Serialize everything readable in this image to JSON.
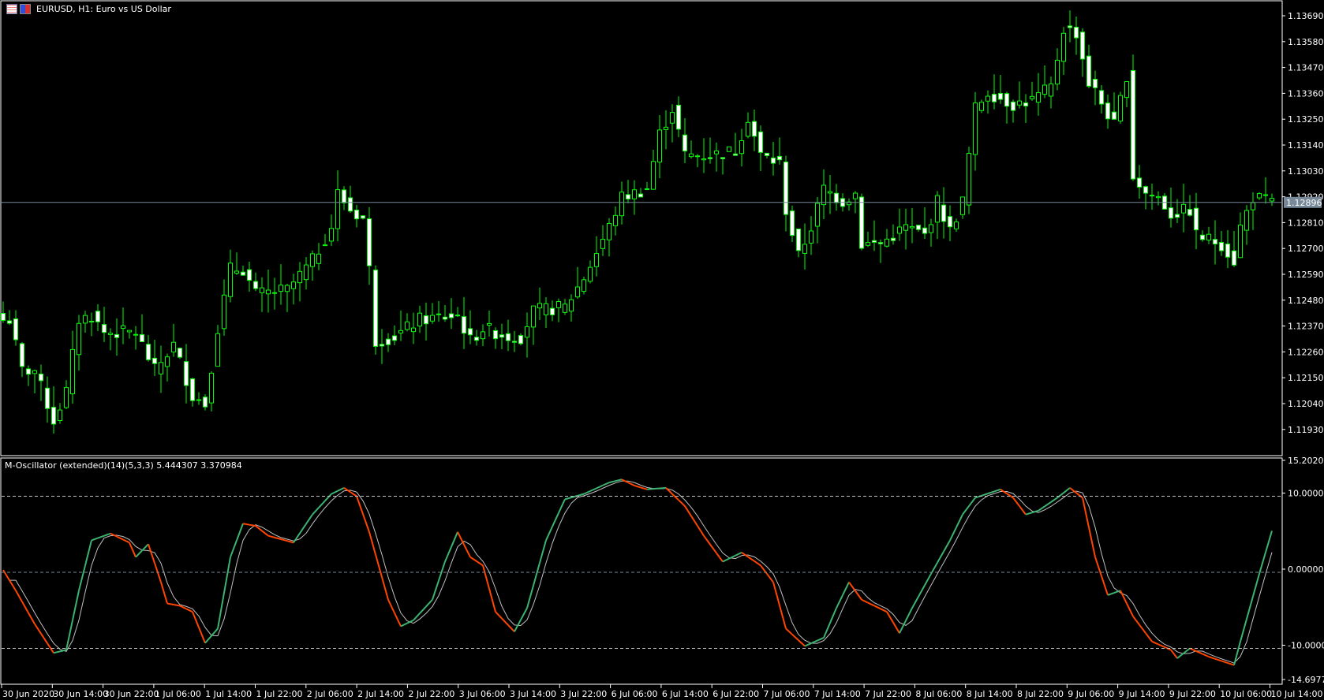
{
  "header": {
    "title": "EURUSD, H1:  Euro vs US Dollar",
    "icons": [
      "chart-window-icon",
      "trade-icon"
    ]
  },
  "current_price": {
    "value": 1.12896,
    "label": "1.12896",
    "line_color": "#778899"
  },
  "indicator": {
    "label": "M-Oscillator (extended)(14)(5,3,3) 5.444307 3.370984",
    "main_value": 5.444307,
    "signal_value": 3.370984,
    "up_color": "#3cb371",
    "down_color": "#ff4500",
    "signal_color": "#c0c0c0"
  },
  "colors": {
    "candle": "#00ff00",
    "bear_fill": "#ffffff",
    "bull_fill": "#000000",
    "grid": "#ffffff"
  },
  "chart_data": [
    {
      "type": "candlestick",
      "title": "EURUSD, H1",
      "bar_count": 202,
      "y_ticks": [
        "1.13690",
        "1.13580",
        "1.13470",
        "1.13360",
        "1.13250",
        "1.13140",
        "1.13030",
        "1.12920",
        "1.12810",
        "1.12700",
        "1.12590",
        "1.12480",
        "1.12370",
        "1.12260",
        "1.12150",
        "1.12040",
        "1.11930"
      ],
      "ylim": [
        1.1184,
        1.1375
      ],
      "close_path": [
        [
          1,
          1.12397
        ],
        [
          3,
          1.12181
        ],
        [
          5,
          1.12181
        ],
        [
          8,
          1.11966
        ],
        [
          10,
          1.12092
        ],
        [
          12,
          1.12397
        ],
        [
          14,
          1.12415
        ],
        [
          16,
          1.12343
        ],
        [
          21,
          1.12343
        ],
        [
          24,
          1.12181
        ],
        [
          27,
          1.12289
        ],
        [
          30,
          1.12074
        ],
        [
          32,
          1.12038
        ],
        [
          34,
          1.12361
        ],
        [
          36,
          1.12612
        ],
        [
          38,
          1.12612
        ],
        [
          40,
          1.12505
        ],
        [
          45,
          1.12523
        ],
        [
          49,
          1.12648
        ],
        [
          52,
          1.12792
        ],
        [
          53,
          1.12936
        ],
        [
          55,
          1.12864
        ],
        [
          57,
          1.12828
        ],
        [
          58,
          1.12612
        ],
        [
          59,
          1.12307
        ],
        [
          62,
          1.12325
        ],
        [
          66,
          1.12397
        ],
        [
          72,
          1.12415
        ],
        [
          74,
          1.12307
        ],
        [
          76,
          1.12361
        ],
        [
          80,
          1.12325
        ],
        [
          82,
          1.12325
        ],
        [
          84,
          1.12433
        ],
        [
          89,
          1.12451
        ],
        [
          92,
          1.12576
        ],
        [
          96,
          1.12792
        ],
        [
          98,
          1.12918
        ],
        [
          102,
          1.12954
        ],
        [
          104,
          1.13187
        ],
        [
          106,
          1.13295
        ],
        [
          108,
          1.13097
        ],
        [
          112,
          1.13097
        ],
        [
          116,
          1.13115
        ],
        [
          118,
          1.13259
        ],
        [
          120,
          1.13097
        ],
        [
          123,
          1.13061
        ],
        [
          124,
          1.12864
        ],
        [
          126,
          1.12666
        ],
        [
          128,
          1.12792
        ],
        [
          130,
          1.12954
        ],
        [
          133,
          1.129
        ],
        [
          135,
          1.12936
        ],
        [
          136,
          1.1272
        ],
        [
          139,
          1.1272
        ],
        [
          143,
          1.12792
        ],
        [
          146,
          1.12756
        ],
        [
          148,
          1.129
        ],
        [
          150,
          1.12774
        ],
        [
          152,
          1.129
        ],
        [
          154,
          1.13295
        ],
        [
          156,
          1.13367
        ],
        [
          160,
          1.13313
        ],
        [
          163,
          1.13331
        ],
        [
          166,
          1.13385
        ],
        [
          168,
          1.13636
        ],
        [
          170,
          1.13618
        ],
        [
          172,
          1.13403
        ],
        [
          173,
          1.13367
        ],
        [
          176,
          1.13223
        ],
        [
          178,
          1.13439
        ],
        [
          179,
          1.13008
        ],
        [
          181,
          1.12936
        ],
        [
          183,
          1.12918
        ],
        [
          185,
          1.12846
        ],
        [
          188,
          1.12864
        ],
        [
          189,
          1.12756
        ],
        [
          193,
          1.1272
        ],
        [
          195,
          1.12648
        ],
        [
          196,
          1.12792
        ],
        [
          198,
          1.12918
        ],
        [
          201,
          1.12896
        ]
      ]
    },
    {
      "type": "line",
      "title": "M-Oscillator (extended)(14)(5,3,3)",
      "y_ticks": [
        "15.202020",
        "10.000000",
        "0.000000",
        "-10.000000",
        "-14.697713"
      ],
      "levels": [
        10,
        0,
        -10
      ],
      "ylim": [
        -14.697713,
        15.20202
      ],
      "main_path": [
        [
          0,
          0.3
        ],
        [
          2,
          -2.4
        ],
        [
          5,
          -6.8
        ],
        [
          8,
          -10.6
        ],
        [
          10,
          -10.2
        ],
        [
          12,
          -2.4
        ],
        [
          14,
          4.2
        ],
        [
          17,
          5.1
        ],
        [
          20,
          3.9
        ],
        [
          21,
          2.0
        ],
        [
          23,
          3.7
        ],
        [
          25,
          -1.3
        ],
        [
          26,
          -4.1
        ],
        [
          28,
          -4.4
        ],
        [
          30,
          -5.2
        ],
        [
          32,
          -9.3
        ],
        [
          34,
          -7.4
        ],
        [
          36,
          2.0
        ],
        [
          38,
          6.4
        ],
        [
          40,
          6.1
        ],
        [
          42,
          4.8
        ],
        [
          46,
          3.9
        ],
        [
          49,
          7.6
        ],
        [
          52,
          10.3
        ],
        [
          54,
          11.1
        ],
        [
          56,
          10.0
        ],
        [
          58,
          5.3
        ],
        [
          61,
          -3.6
        ],
        [
          63,
          -7.1
        ],
        [
          65,
          -6.3
        ],
        [
          68,
          -3.6
        ],
        [
          70,
          1.4
        ],
        [
          72,
          5.3
        ],
        [
          74,
          2.0
        ],
        [
          76,
          0.9
        ],
        [
          78,
          -5.2
        ],
        [
          81,
          -7.8
        ],
        [
          83,
          -4.7
        ],
        [
          86,
          4.2
        ],
        [
          89,
          9.6
        ],
        [
          92,
          10.3
        ],
        [
          96,
          11.8
        ],
        [
          98,
          12.2
        ],
        [
          100,
          11.4
        ],
        [
          102,
          10.9
        ],
        [
          105,
          11.1
        ],
        [
          108,
          8.7
        ],
        [
          111,
          4.8
        ],
        [
          114,
          1.4
        ],
        [
          117,
          2.6
        ],
        [
          120,
          0.9
        ],
        [
          122,
          -1.3
        ],
        [
          124,
          -7.4
        ],
        [
          127,
          -9.7
        ],
        [
          130,
          -8.6
        ],
        [
          132,
          -4.7
        ],
        [
          134,
          -1.3
        ],
        [
          136,
          -3.6
        ],
        [
          140,
          -5.2
        ],
        [
          142,
          -8.0
        ],
        [
          144,
          -4.7
        ],
        [
          147,
          -0.2
        ],
        [
          150,
          4.2
        ],
        [
          152,
          7.6
        ],
        [
          154,
          9.8
        ],
        [
          158,
          10.9
        ],
        [
          160,
          9.8
        ],
        [
          162,
          7.6
        ],
        [
          164,
          8.1
        ],
        [
          167,
          9.8
        ],
        [
          169,
          11.1
        ],
        [
          171,
          9.8
        ],
        [
          173,
          2.0
        ],
        [
          175,
          -3.0
        ],
        [
          177,
          -2.4
        ],
        [
          179,
          -5.8
        ],
        [
          182,
          -9.1
        ],
        [
          185,
          -10.2
        ],
        [
          186,
          -11.3
        ],
        [
          188,
          -10.0
        ],
        [
          191,
          -11.1
        ],
        [
          195,
          -12.2
        ],
        [
          196,
          -9.1
        ],
        [
          199,
          -0.2
        ],
        [
          201,
          5.444307
        ]
      ]
    }
  ],
  "time_axis": [
    "30 Jun 2020",
    "30 Jun 14:00",
    "30 Jun 22:00",
    "1 Jul 06:00",
    "1 Jul 14:00",
    "1 Jul 22:00",
    "2 Jul 06:00",
    "2 Jul 14:00",
    "2 Jul 22:00",
    "3 Jul 06:00",
    "3 Jul 14:00",
    "3 Jul 22:00",
    "6 Jul 06:00",
    "6 Jul 14:00",
    "6 Jul 22:00",
    "7 Jul 06:00",
    "7 Jul 14:00",
    "7 Jul 22:00",
    "8 Jul 06:00",
    "8 Jul 14:00",
    "8 Jul 22:00",
    "9 Jul 06:00",
    "9 Jul 14:00",
    "9 Jul 22:00",
    "10 Jul 06:00",
    "10 Jul 14:00"
  ]
}
